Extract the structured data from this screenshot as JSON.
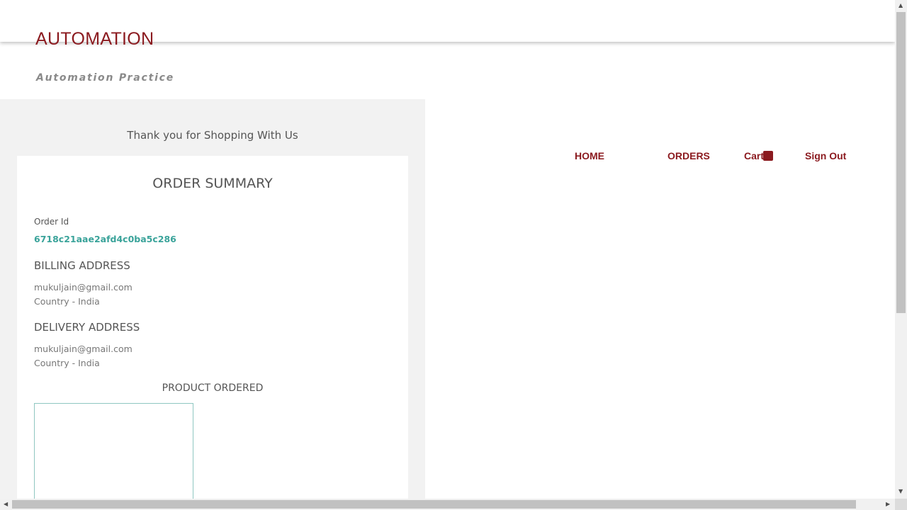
{
  "header": {
    "brand_title": "AUTOMATION",
    "brand_subtitle": "Automation Practice"
  },
  "nav": {
    "home": "HOME",
    "orders": "ORDERS",
    "cart": "Cart",
    "sign_out": "Sign Out"
  },
  "confirmation": {
    "thanks": "Thank you for Shopping With Us",
    "summary_title": "ORDER SUMMARY",
    "order_id_label": "Order Id",
    "order_id": "6718c21aae2afd4c0ba5c286",
    "billing": {
      "heading": "BILLING ADDRESS",
      "email": "mukuljain@gmail.com",
      "country": "Country - India"
    },
    "delivery": {
      "heading": "DELIVERY ADDRESS",
      "email": "mukuljain@gmail.com",
      "country": "Country - India"
    },
    "product_heading": "PRODUCT ORDERED"
  },
  "colors": {
    "brand": "#8b1a1f",
    "accent_teal": "#3aa39a",
    "panel_bg": "#f2f2f2"
  }
}
